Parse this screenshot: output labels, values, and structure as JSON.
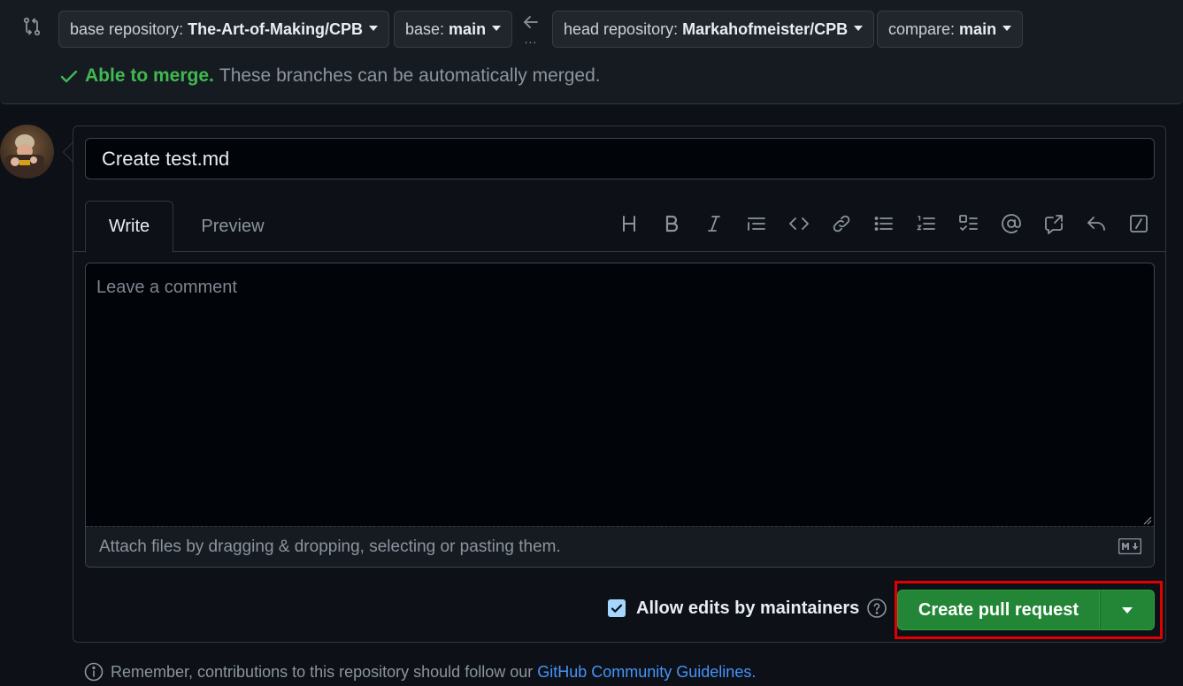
{
  "compare": {
    "base_repo_label": "base repository:",
    "base_repo_value": "The-Art-of-Making/CPB",
    "base_label": "base:",
    "base_value": "main",
    "head_repo_label": "head repository:",
    "head_repo_value": "Markahofmeister/CPB",
    "compare_label": "compare:",
    "compare_value": "main",
    "arrow_dots": "...",
    "merge_ok": "Able to merge.",
    "merge_msg": "These branches can be automatically merged."
  },
  "composer": {
    "title_value": "Create test.md",
    "tab_write": "Write",
    "tab_preview": "Preview",
    "comment_placeholder": "Leave a comment",
    "attach_text": "Attach files by dragging & dropping, selecting or pasting them.",
    "toolbar_icons": [
      "heading-icon",
      "bold-icon",
      "italic-icon",
      "quote-icon",
      "code-icon",
      "link-icon",
      "bulleted-list-icon",
      "numbered-list-icon",
      "task-list-icon",
      "mention-icon",
      "cross-reference-icon",
      "saved-reply-icon",
      "slash-commands-icon"
    ]
  },
  "actions": {
    "allow_edits_label": "Allow edits by maintainers",
    "allow_edits_checked": true,
    "create_button": "Create pull request"
  },
  "footer": {
    "note_text": "Remember, contributions to this repository should follow our",
    "note_link": "GitHub Community Guidelines."
  },
  "colors": {
    "accent_green": "#238636",
    "success_text": "#3fb950",
    "link": "#4493f8",
    "highlight": "#e00000"
  }
}
